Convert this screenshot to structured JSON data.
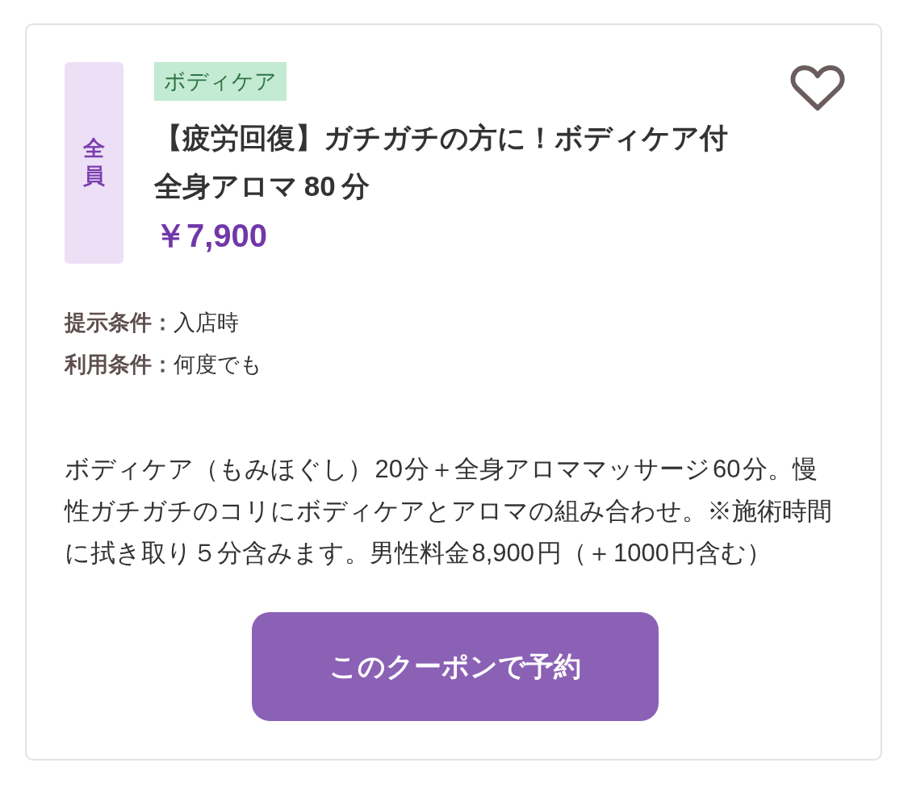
{
  "coupon": {
    "audience_badge": "全員",
    "category_tag": "ボディケア",
    "title": "【疲労回復】ガチガチの方に！ボディケア付全身アロマ80分",
    "price": "￥7,900",
    "favorited": false
  },
  "conditions": [
    {
      "label": "提示条件：",
      "value": "入店時"
    },
    {
      "label": "利用条件：",
      "value": "何度でも"
    }
  ],
  "description": "ボディケア（もみほぐし）20分＋全身アロママッサージ60分。慢性ガチガチのコリにボディケアとアロマの組み合わせ。※施術時間に拭き取り５分含みます。男性料金8,900円（＋1000円含む）",
  "button": {
    "label": "このクーポンで予約"
  }
}
